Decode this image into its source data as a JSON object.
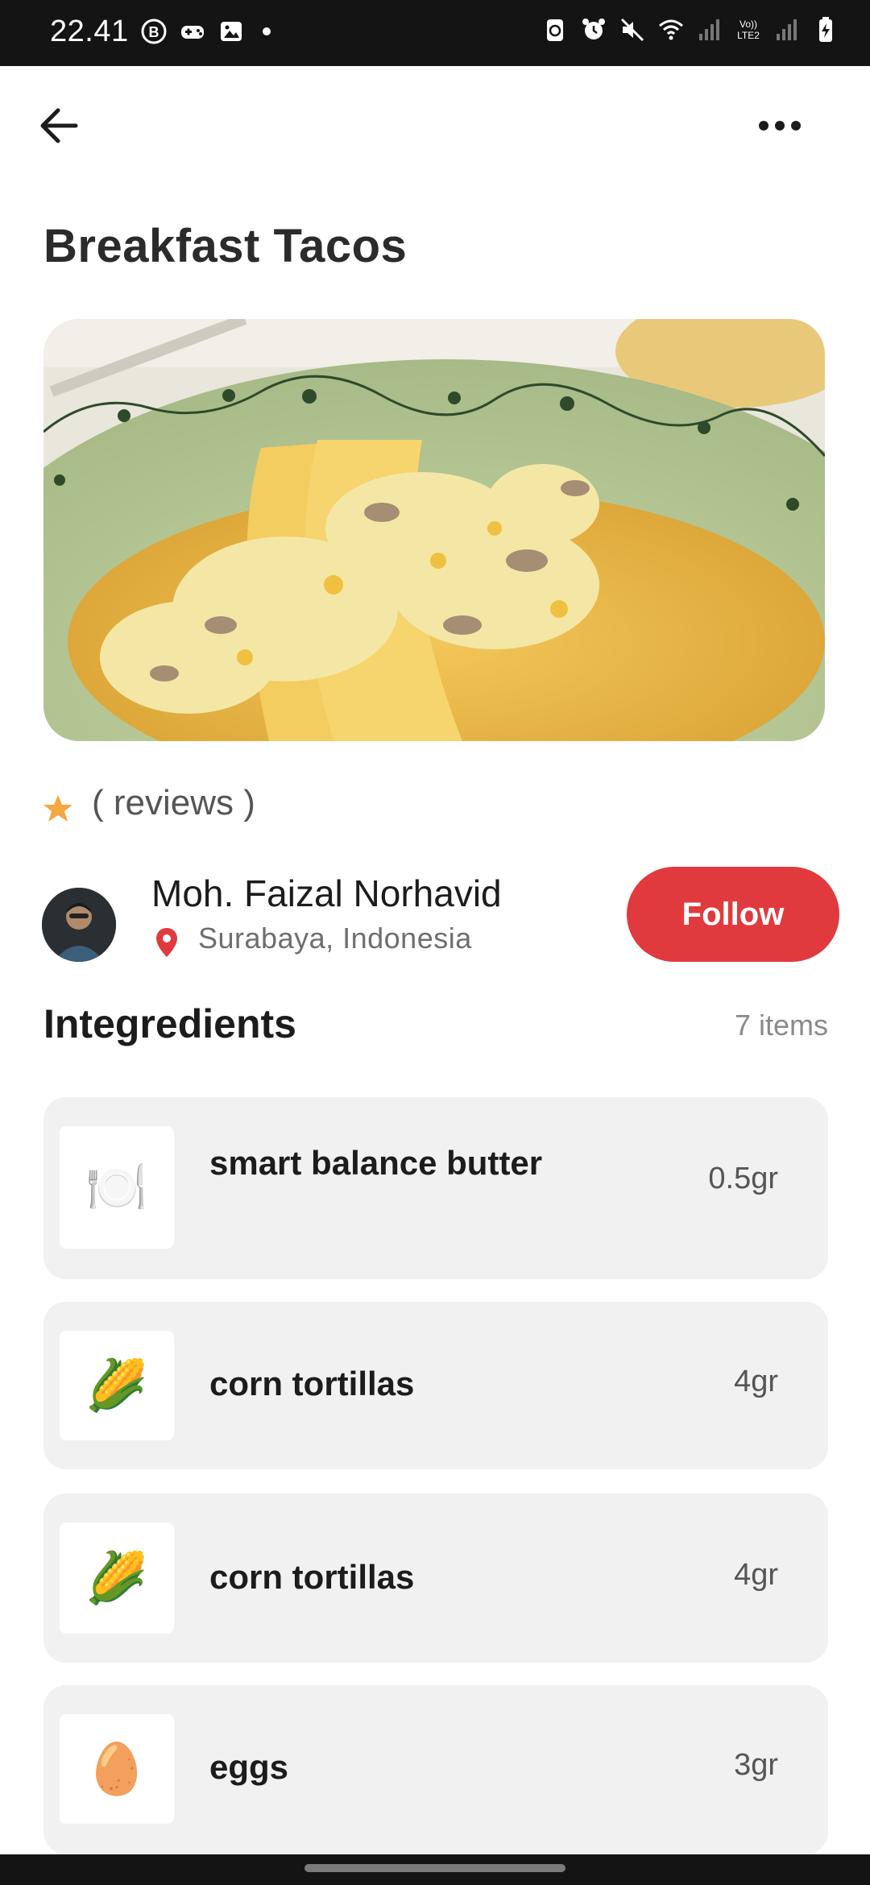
{
  "status_bar": {
    "time": "22.41",
    "left_icons": [
      "b-circle-icon",
      "game-controller-icon",
      "image-icon",
      "dot-icon"
    ],
    "right_icons": [
      "recycle-icon",
      "alarm-icon",
      "mute-icon",
      "wifi-icon",
      "signal-icon",
      "volte-icon",
      "signal-icon",
      "battery-icon"
    ],
    "volte_label": "Vo))\nLTE2"
  },
  "header": {
    "back_icon": "arrow-left-icon",
    "more_icon": "more-horizontal-icon"
  },
  "recipe": {
    "title": "Breakfast Tacos",
    "rating_icon": "star-icon",
    "reviews_label": "( reviews )"
  },
  "author": {
    "name": "Moh. Faizal Norhavid",
    "location": "Surabaya, Indonesia",
    "follow_label": "Follow"
  },
  "ingredients": {
    "title": "Integredients",
    "count_label": "7 items",
    "items": [
      {
        "name": "smart balance butter",
        "qty": "0.5gr",
        "icon": "🍽️"
      },
      {
        "name": "corn tortillas",
        "qty": "4gr",
        "icon": "🌽"
      },
      {
        "name": "corn tortillas",
        "qty": "4gr",
        "icon": "🌽"
      },
      {
        "name": "eggs",
        "qty": "3gr",
        "icon": "🥚"
      }
    ]
  },
  "colors": {
    "accent": "#e03a3e",
    "star": "#f5a742",
    "card_bg": "#f1f1f1"
  }
}
